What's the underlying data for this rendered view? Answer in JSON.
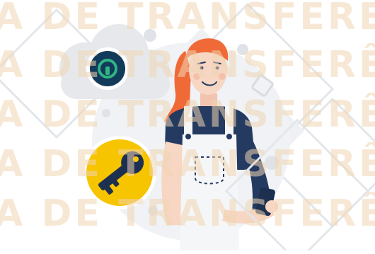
{
  "watermark": {
    "rows": [
      "A DE TRANSFERÊN",
      "A DE TRANSFERÊN",
      "A DE TRANSFERÊN",
      "A DE TRANSFERÊN",
      "A DE TRANSFERÊN"
    ]
  },
  "colors": {
    "background": "#ffffff",
    "shape_gray": "#ebedf0",
    "cloud_gray": "#e6e8eb",
    "lock_badge_navy": "#123a5a",
    "lock_badge_green": "#2fb482",
    "key_badge_yellow": "#f7c400",
    "key_navy": "#1e3050",
    "hair_orange": "#f06a38",
    "shirt_navy": "#243a60",
    "overalls_white": "#f5f6f8",
    "skin": "#f7d6c4",
    "watermark_tint": "#f1d6b2"
  },
  "icons": {
    "lock": "keyhole-lock-icon",
    "key": "key-icon",
    "phone": "smartphone-icon"
  }
}
